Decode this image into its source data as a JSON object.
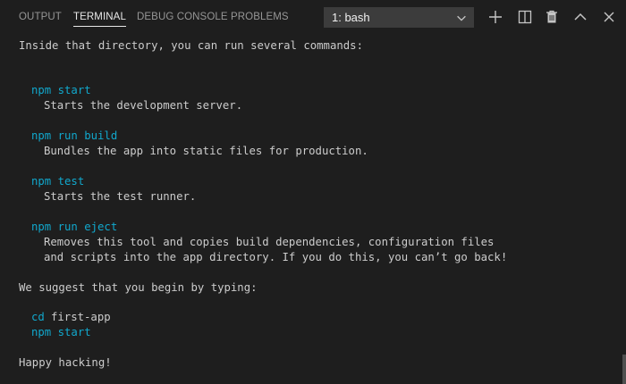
{
  "tabs": [
    {
      "label": "OUTPUT",
      "active": false
    },
    {
      "label": "TERMINAL",
      "active": true
    },
    {
      "label": "DEBUG CONSOLE",
      "active": false
    },
    {
      "label": "PROBLEMS",
      "active": false
    }
  ],
  "terminal_select": {
    "value": "1: bash"
  },
  "toolbar": {
    "icons": [
      "plus-icon",
      "split-icon",
      "trash-icon",
      "chevron-up-icon",
      "close-icon"
    ]
  },
  "colors": {
    "background": "#1e1e1e",
    "text": "#cccccc",
    "command": "#11a8cd",
    "tab_active": "#e7e7e7",
    "tab_inactive": "#969696"
  },
  "terminal": {
    "lines": [
      {
        "text": "Inside that directory, you can run several commands:",
        "kind": "text"
      },
      {
        "text": "npm start",
        "kind": "cmd"
      },
      {
        "text": "Starts the development server.",
        "kind": "text"
      },
      {
        "text": "npm run build",
        "kind": "cmd"
      },
      {
        "text": "Bundles the app into static files for production.",
        "kind": "text"
      },
      {
        "text": "npm test",
        "kind": "cmd"
      },
      {
        "text": "Starts the test runner.",
        "kind": "text"
      },
      {
        "text": "npm run eject",
        "kind": "cmd"
      },
      {
        "text": "Removes this tool and copies build dependencies, configuration files",
        "kind": "text"
      },
      {
        "text": "and scripts into the app directory. If you do this, you can’t go back!",
        "kind": "text"
      },
      {
        "text": "We suggest that you begin by typing:",
        "kind": "text"
      },
      {
        "text": "cd",
        "kind": "cmd"
      },
      {
        "text": "first-app",
        "kind": "text"
      },
      {
        "text": "npm start",
        "kind": "cmd"
      },
      {
        "text": "Happy hacking!",
        "kind": "text"
      }
    ]
  }
}
